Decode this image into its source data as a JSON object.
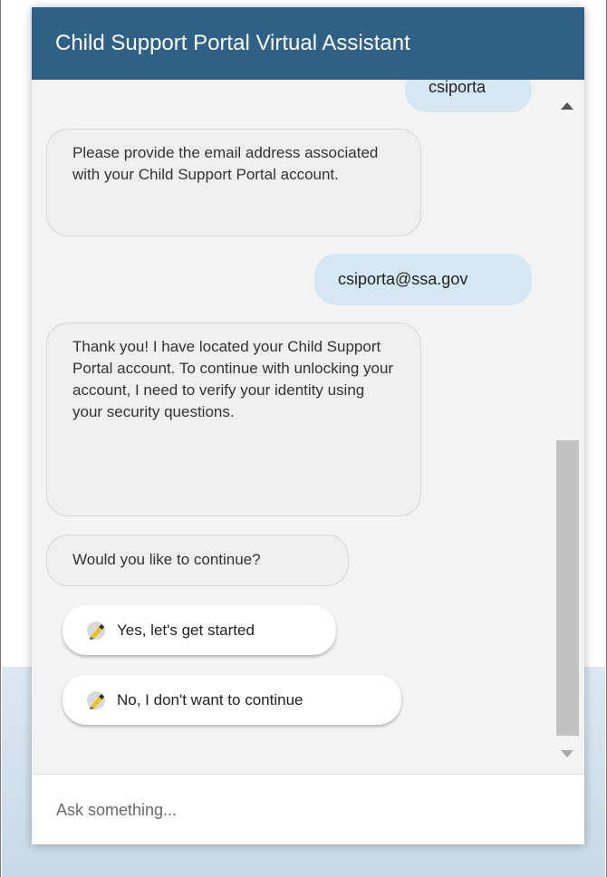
{
  "header": {
    "title": "Child Support Portal Virtual Assistant"
  },
  "messages": [
    {
      "from": "user",
      "text": "csiporta"
    },
    {
      "from": "bot",
      "text": "Please provide the email address associated with your Child Support Portal account."
    },
    {
      "from": "user",
      "text": "csiporta@ssa.gov"
    },
    {
      "from": "bot",
      "text": "Thank you! I have located your Child Support Portal account. To continue with unlocking your account, I need to verify your identity using your security questions."
    },
    {
      "from": "bot",
      "text": "Would you like to continue?"
    }
  ],
  "quick_replies": [
    {
      "label": "Yes, let's get started",
      "icon": "pencil-icon"
    },
    {
      "label": "No, I don't want to continue",
      "icon": "pencil-icon"
    }
  ],
  "input": {
    "placeholder": "Ask something..."
  },
  "colors": {
    "header": "#2f6187",
    "user_bubble": "#d5e7f3",
    "bot_bubble": "#efefef",
    "panel": "#f3f3f3"
  }
}
